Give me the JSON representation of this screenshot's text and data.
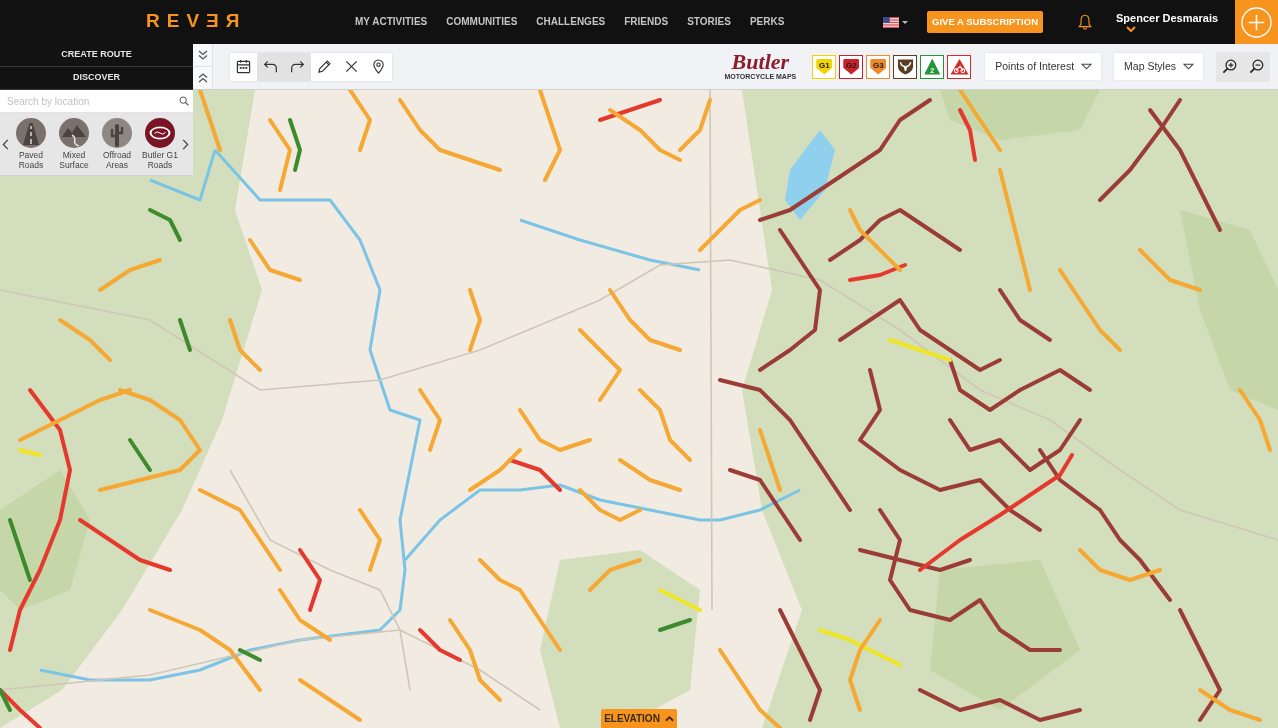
{
  "header": {
    "logo": "REVƎЯ",
    "nav": [
      {
        "label": "MY ACTIVITIES",
        "selected": false
      },
      {
        "label": "COMMUNITIES",
        "selected": false
      },
      {
        "label": "CHALLENGES",
        "selected": false
      },
      {
        "label": "FRIENDS",
        "selected": false
      },
      {
        "label": "STORIES",
        "selected": false
      },
      {
        "label": "PERKS",
        "selected": false
      }
    ],
    "subscription_button": "GIVE A SUBSCRIPTION",
    "user": {
      "name": "Spencer Desmarais"
    }
  },
  "sidebar": {
    "buttons": [
      "CREATE ROUTE",
      "DISCOVER"
    ],
    "search": {
      "placeholder": "Search by location"
    },
    "road_types": [
      {
        "kind": "paved",
        "label": "Paved Roads"
      },
      {
        "kind": "mixed",
        "label": "Mixed Surface"
      },
      {
        "kind": "offroad",
        "label": "Offroad Areas"
      },
      {
        "kind": "butler",
        "label": "Butler G1 Roads"
      }
    ]
  },
  "toolbar": {
    "tools": [
      {
        "kind": "calendar",
        "disabled": false
      },
      {
        "kind": "undo",
        "disabled": true
      },
      {
        "kind": "redo",
        "disabled": true
      },
      {
        "kind": "pencil",
        "disabled": false
      },
      {
        "kind": "clear",
        "disabled": false
      },
      {
        "kind": "pin",
        "disabled": false
      }
    ],
    "brand": {
      "name": "Butler",
      "tagline": "MOTORCYCLE MAPS"
    },
    "badges": [
      {
        "kind": "shield",
        "label": "G1",
        "color": "#f2d400"
      },
      {
        "kind": "shield",
        "label": "G2",
        "color": "#c9202a"
      },
      {
        "kind": "shield",
        "label": "G3",
        "color": "#ee8a2a"
      },
      {
        "kind": "crest",
        "color": "#5a3d24"
      },
      {
        "kind": "triangle",
        "label": "2",
        "color": "#23963a"
      },
      {
        "kind": "bike",
        "color": "#d42a2a"
      }
    ],
    "dropdowns": [
      "Points of Interest",
      "Map Styles"
    ]
  },
  "elevation_button": "ELEVATION"
}
